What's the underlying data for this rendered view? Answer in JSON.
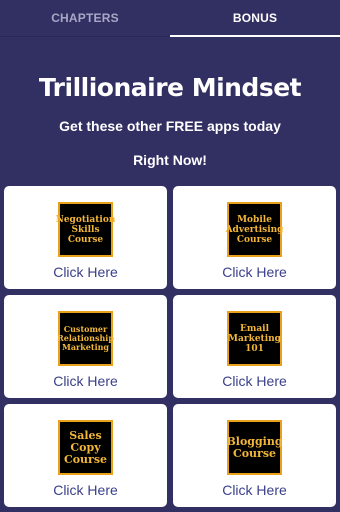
{
  "tabs": [
    {
      "label": "CHAPTERS",
      "active": false
    },
    {
      "label": "BONUS",
      "active": true
    }
  ],
  "header": {
    "title": "Trillionaire Mindset",
    "subtitle": "Get these other FREE apps today",
    "subtitle2": "Right Now!"
  },
  "apps": [
    {
      "thumb_text": "Negotiation Skills Course",
      "action": "Click Here"
    },
    {
      "thumb_text": "Mobile Advertising Course",
      "action": "Click Here"
    },
    {
      "thumb_text": "Customer Relationship Marketing",
      "action": "Click Here"
    },
    {
      "thumb_text": "Email Marketing 101",
      "action": "Click Here"
    },
    {
      "thumb_text": "Sales Copy Course",
      "action": "Click Here"
    },
    {
      "thumb_text": "Blogging Course",
      "action": "Click Here"
    }
  ],
  "colors": {
    "background": "#322f63",
    "card": "#ffffff",
    "thumb_text": "#f2b63a",
    "thumb_border": "#e8a21a",
    "link_text": "#3a3f8a"
  }
}
